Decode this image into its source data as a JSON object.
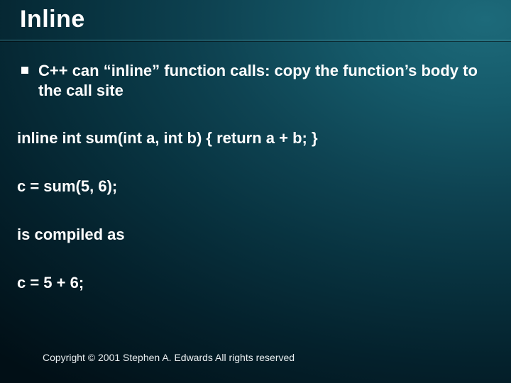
{
  "title": "Inline",
  "bullet": "C++ can “inline” function calls: copy the function’s body to the call site",
  "code1": "inline int sum(int a, int b) { return a + b; }",
  "code2": "c = sum(5, 6);",
  "compiled_label": "is compiled as",
  "code3": "c = 5 + 6;",
  "copyright": "Copyright © 2001 Stephen A. Edwards  All rights reserved"
}
